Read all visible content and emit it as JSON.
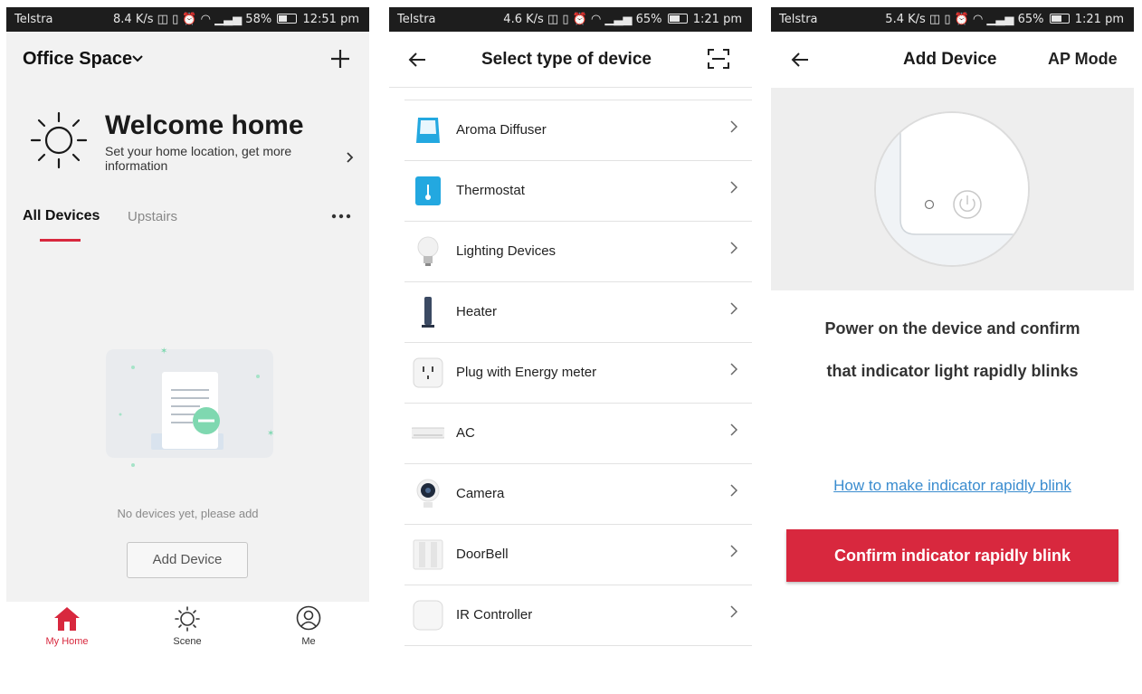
{
  "colors": {
    "accent": "#d8283e",
    "link": "#3a8ccf"
  },
  "screen1": {
    "status": {
      "carrier": "Telstra",
      "speed": "8.4 K/s",
      "battery": "58%",
      "time": "12:51 pm"
    },
    "header": {
      "home_name": "Office Space",
      "home_icon": "chevron-down-icon",
      "add_icon": "plus-icon"
    },
    "welcome": {
      "title": "Welcome home",
      "subtitle": "Set your home location, get more information",
      "icon": "sun-icon"
    },
    "tabs": [
      {
        "label": "All Devices",
        "active": true
      },
      {
        "label": "Upstairs",
        "active": false
      }
    ],
    "empty": {
      "message": "No devices yet, please add",
      "button": "Add Device"
    },
    "bottom_nav": [
      {
        "label": "My Home",
        "icon": "home-icon",
        "active": true
      },
      {
        "label": "Scene",
        "icon": "sun-icon",
        "active": false
      },
      {
        "label": "Me",
        "icon": "user-icon",
        "active": false
      }
    ]
  },
  "screen2": {
    "status": {
      "carrier": "Telstra",
      "speed": "4.6 K/s",
      "battery": "65%",
      "time": "1:21 pm"
    },
    "header": {
      "title": "Select type of device",
      "back_icon": "arrow-left-icon",
      "scan_icon": "scan-icon"
    },
    "devices": [
      {
        "label": "Aroma Diffuser",
        "icon": "aroma-diffuser-icon"
      },
      {
        "label": "Thermostat",
        "icon": "thermostat-icon"
      },
      {
        "label": "Lighting Devices",
        "icon": "bulb-icon"
      },
      {
        "label": "Heater",
        "icon": "heater-icon"
      },
      {
        "label": "Plug with Energy meter",
        "icon": "plug-icon"
      },
      {
        "label": "AC",
        "icon": "ac-icon"
      },
      {
        "label": "Camera",
        "icon": "camera-icon"
      },
      {
        "label": "DoorBell",
        "icon": "doorbell-icon"
      },
      {
        "label": "IR Controller",
        "icon": "ir-controller-icon"
      }
    ]
  },
  "screen3": {
    "status": {
      "carrier": "Telstra",
      "speed": "5.4 K/s",
      "battery": "65%",
      "time": "1:21 pm"
    },
    "header": {
      "title": "Add Device",
      "ap_mode": "AP Mode",
      "back_icon": "arrow-left-icon"
    },
    "instruction_line1": "Power on the device and confirm",
    "instruction_line2": "that indicator light rapidly blinks",
    "help_link": "How to make indicator rapidly blink",
    "confirm_button": "Confirm indicator rapidly blink"
  }
}
